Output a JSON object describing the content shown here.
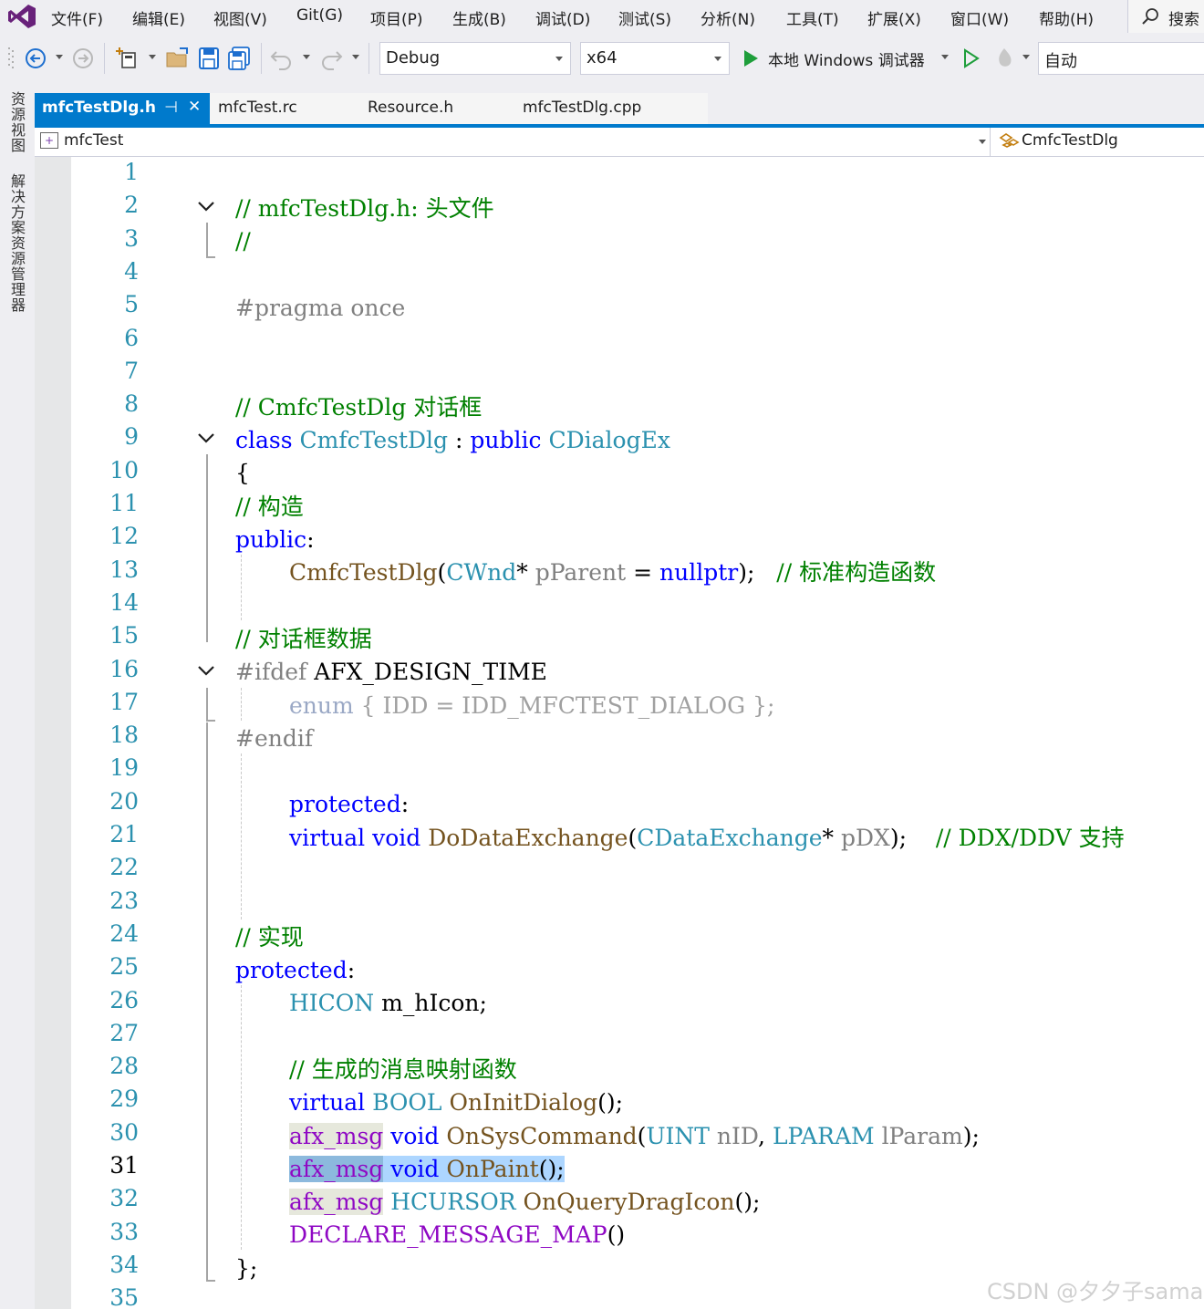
{
  "menu": [
    "文件(F)",
    "编辑(E)",
    "视图(V)",
    "Git(G)",
    "项目(P)",
    "生成(B)",
    "调试(D)",
    "测试(S)",
    "分析(N)",
    "工具(T)",
    "扩展(X)",
    "窗口(W)",
    "帮助(H)"
  ],
  "search": {
    "label": "搜索"
  },
  "toolbar": {
    "config": "Debug",
    "platform": "x64",
    "debugger": "本地 Windows 调试器",
    "auto": "自动"
  },
  "side_tabs": [
    "资源视图",
    "解决方案资源管理器"
  ],
  "tabs": {
    "active": "mfcTestDlg.h",
    "pin": "⊣",
    "close": "✕",
    "others": [
      "mfcTest.rc",
      "Resource.h",
      "mfcTestDlg.cpp"
    ]
  },
  "nav": {
    "project": "mfcTest",
    "class": "CmfcTestDlg"
  },
  "editor": {
    "current_line": "31",
    "line_numbers": [
      "1",
      "2",
      "3",
      "4",
      "5",
      "6",
      "7",
      "8",
      "9",
      "10",
      "11",
      "12",
      "13",
      "14",
      "15",
      "16",
      "17",
      "18",
      "19",
      "20",
      "21",
      "22",
      "23",
      "24",
      "25",
      "26",
      "27",
      "28",
      "29",
      "30",
      "31",
      "32",
      "33",
      "34",
      "35"
    ],
    "code": {
      "l2": "// mfcTestDlg.h: 头文件",
      "l3": "//",
      "l5": "#pragma once",
      "l8": "// CmfcTestDlg 对话框",
      "l9a": "class",
      "l9b": "CmfcTestDlg",
      "l9c": " : ",
      "l9d": "public",
      "l9e": "CDialogEx",
      "l10": "{",
      "l11": "// 构造",
      "l12a": "public",
      "l12b": ":",
      "l13a": "CmfcTestDlg",
      "l13b": "(",
      "l13c": "CWnd",
      "l13d": "* ",
      "l13e": "pParent",
      "l13f": " = ",
      "l13g": "nullptr",
      "l13h": ");",
      "l13i": "// 标准构造函数",
      "l15": "// 对话框数据",
      "l16a": "#ifdef",
      "l16b": " AFX_DESIGN_TIME",
      "l17a": "enum",
      "l17b": " { IDD = IDD_MFCTEST_DIALOG };",
      "l18": "#endif",
      "l20a": "protected",
      "l20b": ":",
      "l21a": "virtual",
      "l21b": "void",
      "l21c": "DoDataExchange",
      "l21d": "(",
      "l21e": "CDataExchange",
      "l21f": "* ",
      "l21g": "pDX",
      "l21h": ");",
      "l21i": "// DDX/DDV 支持",
      "l24": "// 实现",
      "l25a": "protected",
      "l25b": ":",
      "l26a": "HICON",
      "l26b": " m_hIcon;",
      "l28": "// 生成的消息映射函数",
      "l29a": "virtual",
      "l29b": "BOOL",
      "l29c": "OnInitDialog",
      "l29d": "();",
      "l30a": "afx_msg",
      "l30b": "void",
      "l30c": "OnSysCommand",
      "l30d": "(",
      "l30e": "UINT",
      "l30f": "nID",
      "l30g": ", ",
      "l30h": "LPARAM",
      "l30i": "lParam",
      "l30j": ");",
      "l31a": "afx_msg",
      "l31b": "void",
      "l31c": "OnPaint",
      "l31d": "();",
      "l32a": "afx_msg",
      "l32b": "HCURSOR",
      "l32c": "OnQueryDragIcon",
      "l32d": "();",
      "l33a": "DECLARE_MESSAGE_MAP",
      "l33b": "()",
      "l34": "};"
    }
  },
  "watermark": "CSDN @夕夕子sama"
}
